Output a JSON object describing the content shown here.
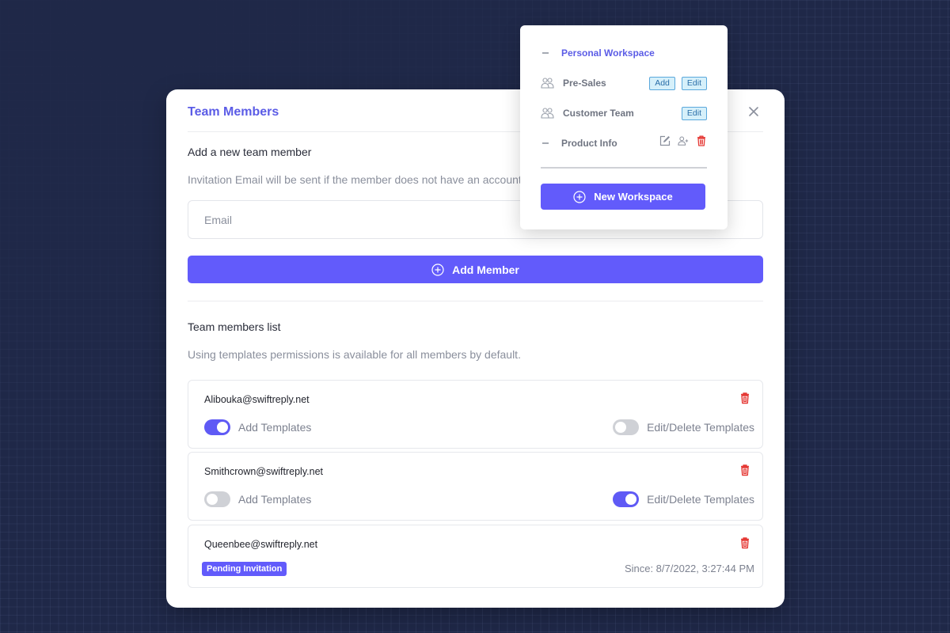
{
  "modal": {
    "title": "Team Members",
    "add_section": {
      "title": "Add a new team member",
      "subtitle": "Invitation Email will be sent if the member does not have an account.",
      "email_placeholder": "Email",
      "email_value": "",
      "add_button_label": "Add Member"
    },
    "list_section": {
      "title": "Team members list",
      "subtitle": "Using templates permissions is available for all members by default."
    },
    "members": [
      {
        "email": "Alibouka@swiftreply.net",
        "add_templates_label": "Add Templates",
        "add_templates_on": true,
        "edit_templates_label": "Edit/Delete Templates",
        "edit_templates_on": false
      },
      {
        "email": "Smithcrown@swiftreply.net",
        "add_templates_label": "Add Templates",
        "add_templates_on": false,
        "edit_templates_label": "Edit/Delete Templates",
        "edit_templates_on": true
      },
      {
        "email": "Queenbee@swiftreply.net",
        "status_badge": "Pending Invitation",
        "since": "Since: 8/7/2022, 3:27:44 PM"
      }
    ]
  },
  "workspace_menu": {
    "items": [
      {
        "label": "Personal Workspace",
        "icon": "dash-icon",
        "active": true
      },
      {
        "label": "Pre-Sales",
        "icon": "users-icon",
        "actions": [
          "Add",
          "Edit"
        ]
      },
      {
        "label": "Customer Team",
        "icon": "users-icon",
        "actions": [
          "Edit"
        ]
      },
      {
        "label": "Product Info",
        "icon": "dash-icon",
        "icon_actions": [
          "edit-icon",
          "add-user-icon",
          "trash-icon"
        ]
      }
    ],
    "new_workspace_label": "New Workspace"
  },
  "colors": {
    "accent": "#625bfb",
    "title": "#5b5ce6",
    "danger": "#e53935",
    "background": "#1f2848",
    "chip_bg": "#d6f0fa",
    "chip_border": "#5aa8dc"
  }
}
